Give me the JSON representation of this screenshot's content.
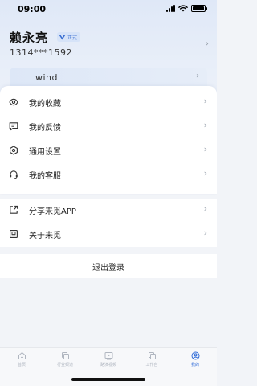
{
  "status_bar": {
    "time": "09:00"
  },
  "profile": {
    "name": "赖永亮",
    "badge": "正式",
    "phone": "1314***1592"
  },
  "wind_card": {
    "label": "wind"
  },
  "menu": {
    "favorites": "我的收藏",
    "feedback": "我的反馈",
    "settings": "通用设置",
    "service": "我的客服",
    "share": "分享来觅APP",
    "about": "关于来觅"
  },
  "logout": {
    "label": "退出登录"
  },
  "tabbar": {
    "tabs": [
      {
        "label": "首页",
        "icon": "home-icon"
      },
      {
        "label": "行业频道",
        "icon": "copy-icon"
      },
      {
        "label": "路演视频",
        "icon": "video-icon"
      },
      {
        "label": "工作台",
        "icon": "workspace-icon"
      },
      {
        "label": "我的",
        "icon": "user-icon",
        "active": true
      }
    ]
  },
  "colors": {
    "accent": "#2f6bd8",
    "chevron": "#9aa2ad",
    "inactive_tab": "#b0b6c0"
  }
}
